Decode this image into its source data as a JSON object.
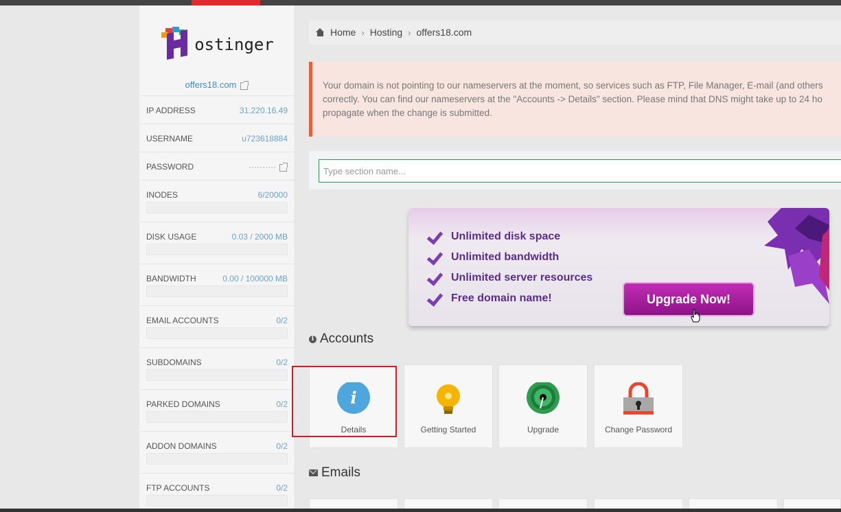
{
  "sidebar": {
    "domain": "offers18.com",
    "logo_text": "ostinger",
    "logo_letter": "H",
    "stats": [
      {
        "label": "IP ADDRESS",
        "value": "31.220.16.49",
        "bar": false
      },
      {
        "label": "USERNAME",
        "value": "u723618884",
        "bar": false
      },
      {
        "label": "PASSWORD",
        "value": "··········",
        "bar": false
      },
      {
        "label": "INODES",
        "value": "6/20000",
        "bar": true,
        "fill_fraction": 0.0003
      },
      {
        "label": "DISK USAGE",
        "value": "0.03 / 2000 MB",
        "bar": true,
        "fill_fraction": 0.0
      },
      {
        "label": "BANDWIDTH",
        "value": "0.00 / 100000 MB",
        "bar": true,
        "fill_fraction": 0.0
      },
      {
        "label": "EMAIL ACCOUNTS",
        "value": "0/2",
        "bar": true,
        "fill_fraction": 0.0
      },
      {
        "label": "SUBDOMAINS",
        "value": "0/2",
        "bar": true,
        "fill_fraction": 0.0
      },
      {
        "label": "PARKED DOMAINS",
        "value": "0/2",
        "bar": true,
        "fill_fraction": 0.0
      },
      {
        "label": "ADDON DOMAINS",
        "value": "0/2",
        "bar": true,
        "fill_fraction": 0.0
      },
      {
        "label": "FTP ACCOUNTS",
        "value": "0/2",
        "bar": true,
        "fill_fraction": 0.0
      }
    ]
  },
  "breadcrumb": [
    "Home",
    "Hosting",
    "offers18.com"
  ],
  "alert": {
    "line1": "Your domain is not pointing to our nameservers at the moment, so services such as FTP, File Manager, E-mail (and others",
    "line2": "correctly. You can find our nameservers at the \"Accounts -> Details\" section. Please mind that DNS might take up to 24 ho",
    "line3": "propagate when the change is submitted."
  },
  "search": {
    "placeholder": "Type section name..."
  },
  "banner": {
    "features": [
      "Unlimited disk space",
      "Unlimited bandwidth",
      "Unlimited server resources",
      "Free domain name!"
    ],
    "button": "Upgrade Now!"
  },
  "sections": {
    "accounts": "Accounts",
    "emails": "Emails"
  },
  "account_cards": [
    {
      "label": "Details",
      "icon": "info-icon"
    },
    {
      "label": "Getting Started",
      "icon": "lightbulb-icon"
    },
    {
      "label": "Upgrade",
      "icon": "speedometer-icon"
    },
    {
      "label": "Change Password",
      "icon": "padlock-icon"
    }
  ],
  "colors": {
    "accent_red": "#e3292e",
    "link_blue": "#3a8fd0",
    "alert_border": "#e8603c",
    "banner_purple": "#5a2c8b",
    "search_border": "#2e9c4f"
  }
}
